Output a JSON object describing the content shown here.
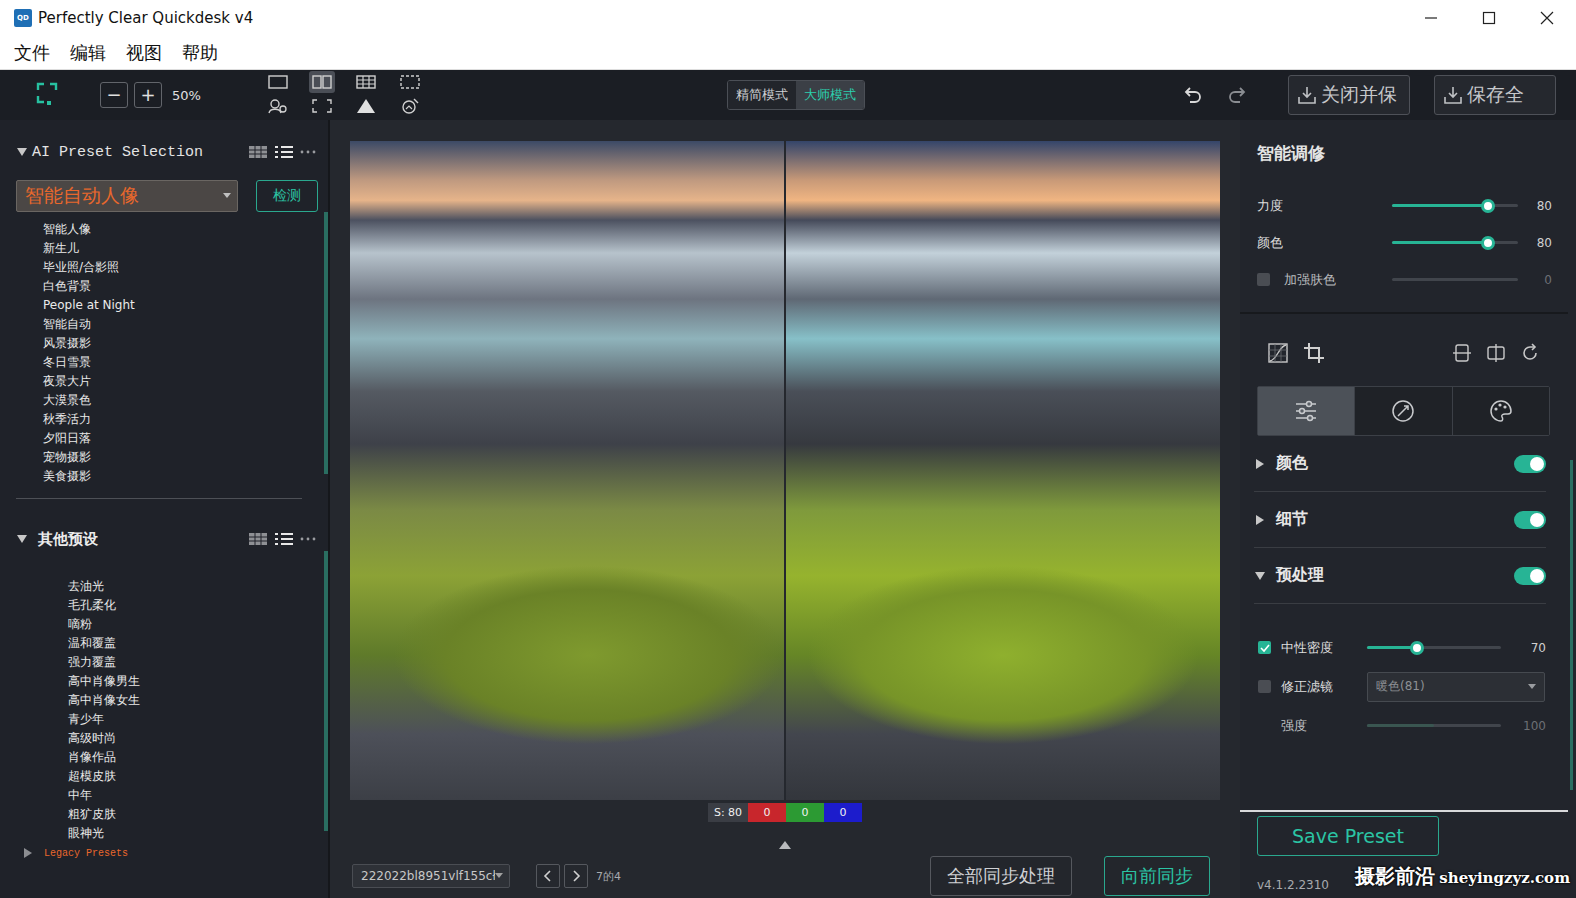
{
  "window": {
    "title": "Perfectly Clear Quickdesk v4",
    "app_icon": "QD"
  },
  "menu": [
    "文件",
    "编辑",
    "视图",
    "帮助"
  ],
  "toolbar": {
    "zoom_out": "−",
    "zoom_in": "+",
    "zoom": "50%",
    "view_modes": [
      {
        "selected": false
      },
      {
        "selected": true
      },
      {
        "selected": false
      },
      {
        "selected": false
      },
      {
        "selected": false
      },
      {
        "selected": false
      },
      {
        "selected": false
      },
      {
        "selected": false
      }
    ],
    "modes": [
      {
        "label": "精简模式",
        "selected": false
      },
      {
        "label": "大师模式",
        "selected": true
      }
    ],
    "buttons": [
      "关闭并保",
      "保存全"
    ]
  },
  "ai_presets": {
    "title": "AI Preset Selection",
    "expanded": true,
    "dropdown": "智能自动人像",
    "detect": "检测",
    "items": [
      {
        "label": "智能人像",
        "selected": false
      },
      {
        "label": "新生儿",
        "selected": false
      },
      {
        "label": "毕业照/合影照",
        "selected": false
      },
      {
        "label": "白色背景",
        "selected": false
      },
      {
        "label": "People at Night",
        "selected": false
      },
      {
        "label": "智能自动",
        "selected": false
      },
      {
        "label": "风景摄影",
        "selected": false
      },
      {
        "label": "冬日雪景",
        "selected": false
      },
      {
        "label": "夜景大片",
        "selected": false
      },
      {
        "label": "大漠景色",
        "selected": false
      },
      {
        "label": "秋季活力",
        "selected": false
      },
      {
        "label": "夕阳日落",
        "selected": false
      },
      {
        "label": "宠物摄影",
        "selected": false
      },
      {
        "label": "美食摄影",
        "selected": false
      }
    ]
  },
  "other_presets": {
    "title": "其他预设",
    "expanded": true,
    "items": [
      {
        "label": "去油光",
        "selected": false
      },
      {
        "label": "毛孔柔化",
        "selected": false
      },
      {
        "label": "嘀粉",
        "selected": false
      },
      {
        "label": "温和覆盖",
        "selected": false
      },
      {
        "label": "强力覆盖",
        "selected": false
      },
      {
        "label": "高中肖像男生",
        "selected": false
      },
      {
        "label": "高中肖像女生",
        "selected": false
      },
      {
        "label": "青少年",
        "selected": false
      },
      {
        "label": "高级时尚",
        "selected": false
      },
      {
        "label": "肖像作品",
        "selected": false
      },
      {
        "label": "超模皮肤",
        "selected": false
      },
      {
        "label": "中年",
        "selected": false
      },
      {
        "label": "粗犷皮肤",
        "selected": false
      },
      {
        "label": "眼神光",
        "selected": false
      }
    ]
  },
  "legacy": {
    "label": "Legacy Presets",
    "expanded": false
  },
  "histogram": [
    {
      "label": "S: 80",
      "color": "#3a3d44"
    },
    {
      "label": "0",
      "color": "#c8262c"
    },
    {
      "label": "0",
      "color": "#2c9a33"
    },
    {
      "label": "0",
      "color": "#1c1ccc"
    }
  ],
  "footer": {
    "file": "222022bl8951vlf155cł",
    "counter": "7的4",
    "buttons": [
      {
        "label": "全部同步处理",
        "primary": false
      },
      {
        "label": "向前同步",
        "primary": true
      }
    ]
  },
  "adjust": {
    "title": "智能调修",
    "sliders": [
      {
        "kind": "slider",
        "label": "力度",
        "value": "80",
        "level": 0.76,
        "checked": false,
        "disabled": false
      },
      {
        "kind": "slider",
        "label": "颜色",
        "value": "80",
        "level": 0.76,
        "checked": false,
        "disabled": false
      },
      {
        "kind": "check-slider",
        "label": "加强肤色",
        "value": "0",
        "level": 0,
        "checked": false,
        "disabled": true
      }
    ]
  },
  "tool_tabs": [
    {
      "selected": true
    },
    {
      "selected": false
    },
    {
      "selected": false
    }
  ],
  "sections": [
    {
      "label": "颜色",
      "expanded": false,
      "on": true,
      "rows": []
    },
    {
      "label": "细节",
      "expanded": false,
      "on": true,
      "rows": []
    },
    {
      "label": "预处理",
      "expanded": true,
      "on": true,
      "rows": [
        {
          "kind": "check-slider",
          "label": "中性密度",
          "checked": true,
          "disabled": false,
          "value": "70",
          "level": 0.37
        },
        {
          "kind": "check-select",
          "label": "修正滤镜",
          "checked": false,
          "disabled": false,
          "value": "暖色(81)",
          "level": 0
        },
        {
          "kind": "slider",
          "label": "强度",
          "checked": false,
          "disabled": true,
          "value": "100",
          "level": 0.5
        }
      ]
    }
  ],
  "save_preset": "Save Preset",
  "version": "v4.1.2.2310",
  "watermark": {
    "name": "摄影前沿",
    "url": "sheyingzyz.com"
  }
}
